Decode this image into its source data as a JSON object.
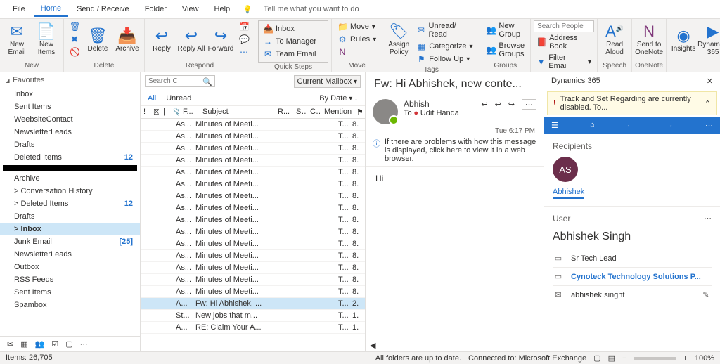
{
  "menu": {
    "file": "File",
    "home": "Home",
    "sendrec": "Send / Receive",
    "folder": "Folder",
    "view": "View",
    "help": "Help",
    "tellme": "Tell me what you want to do"
  },
  "ribbon": {
    "new": {
      "label": "New",
      "email": "New\nEmail",
      "items": "New\nItems"
    },
    "delete": {
      "label": "Delete",
      "del": "Delete",
      "arch": "Archive"
    },
    "respond": {
      "label": "Respond",
      "reply": "Reply",
      "replyall": "Reply\nAll",
      "fwd": "Forward"
    },
    "quick": {
      "label": "Quick Steps",
      "inbox": "Inbox",
      "mgr": "To Manager",
      "team": "Team Email"
    },
    "move": {
      "label": "Move",
      "move": "Move",
      "rules": "Rules"
    },
    "tags": {
      "label": "Tags",
      "assign": "Assign\nPolicy",
      "unread": "Unread/ Read",
      "cat": "Categorize",
      "fu": "Follow Up"
    },
    "groups": {
      "label": "Groups",
      "ng": "New Group",
      "bg": "Browse Groups"
    },
    "find": {
      "label": "Find",
      "ph": "Search People",
      "ab": "Address Book",
      "fe": "Filter Email"
    },
    "speech": {
      "label": "Speech",
      "ra": "Read\nAloud"
    },
    "onenote": {
      "label": "OneNote",
      "so": "Send to\nOneNote"
    },
    "addins": {
      "ins": "Insights",
      "d365": "Dynamics\n365"
    }
  },
  "nav": {
    "fav": "Favorites",
    "favitems": [
      [
        "Inbox",
        ""
      ],
      [
        "Sent Items",
        ""
      ],
      [
        "WeebsiteContact",
        ""
      ],
      [
        "NewsletterLeads",
        ""
      ],
      [
        "Drafts",
        ""
      ],
      [
        "Deleted Items",
        "12"
      ]
    ],
    "acct": "",
    "items": [
      [
        "Archive",
        ""
      ],
      [
        "Conversation History",
        "",
        ">"
      ],
      [
        "Deleted Items",
        "12",
        ">"
      ],
      [
        "Drafts",
        ""
      ],
      [
        "Inbox",
        "",
        "",
        true
      ],
      [
        "Junk Email",
        "[25]"
      ],
      [
        "NewsletterLeads",
        ""
      ],
      [
        "Outbox",
        ""
      ],
      [
        "RSS Feeds",
        ""
      ],
      [
        "Sent Items",
        ""
      ],
      [
        "Spambox",
        ""
      ]
    ]
  },
  "list": {
    "searchph": "Search C",
    "scope": "Current Mailbox",
    "all": "All",
    "unread": "Unread",
    "sort": "By Date",
    "cols": {
      "fr": "F...",
      "subj": "Subject",
      "rec": "R...",
      "sz": "S...",
      "cat": "C...",
      "men": "Mention"
    },
    "rows": [
      [
        "As...",
        "Minutes of Meeti...",
        "T...",
        "8."
      ],
      [
        "As...",
        "Minutes of Meeti...",
        "T...",
        "8."
      ],
      [
        "As...",
        "Minutes of Meeti...",
        "T...",
        "8."
      ],
      [
        "As...",
        "Minutes of Meeti...",
        "T...",
        "8."
      ],
      [
        "As...",
        "Minutes of Meeti...",
        "T...",
        "8."
      ],
      [
        "As...",
        "Minutes of Meeti...",
        "T...",
        "8."
      ],
      [
        "As...",
        "Minutes of Meeti...",
        "T...",
        "8."
      ],
      [
        "As...",
        "Minutes of Meeti...",
        "T...",
        "8."
      ],
      [
        "As...",
        "Minutes of Meeti...",
        "T...",
        "8."
      ],
      [
        "As...",
        "Minutes of Meeti...",
        "T...",
        "8."
      ],
      [
        "As...",
        "Minutes of Meeti...",
        "T...",
        "8."
      ],
      [
        "As...",
        "Minutes of Meeti...",
        "T...",
        "8."
      ],
      [
        "As...",
        "Minutes of Meeti...",
        "T...",
        "8."
      ],
      [
        "As...",
        "Minutes of Meeti...",
        "T...",
        "8."
      ],
      [
        "As...",
        "Minutes of Meeti...",
        "T...",
        "8."
      ],
      [
        "A...",
        "Fw: Hi Abhishek, ...",
        "T...",
        "2.",
        "sel"
      ],
      [
        "St...",
        "New jobs that m...",
        "T...",
        "1."
      ],
      [
        "A...",
        "RE: Claim Your A...",
        "T...",
        "1."
      ]
    ]
  },
  "read": {
    "title": "Fw: Hi Abhishek, new conte...",
    "from": "Abhish",
    "to_lbl": "To",
    "to": "Udit Handa",
    "time": "Tue 6:17 PM",
    "info": "If there are problems with how this message is displayed, click here to view it in a web browser.",
    "body": "Hi"
  },
  "d365": {
    "title": "Dynamics 365",
    "warn": "Track and Set Regarding are currently disabled. To...",
    "recip": "Recipients",
    "initials": "AS",
    "name": "Abhishek",
    "user": "User",
    "fullname": "Abhishek Singh",
    "role": "Sr Tech Lead",
    "company": "Cynoteck Technology Solutions P...",
    "email": "abhishek.singht"
  },
  "status": {
    "items": "Items: 26,705",
    "upd": "All folders are up to date.",
    "conn": "Connected to: Microsoft Exchange",
    "zoom": "100%"
  }
}
